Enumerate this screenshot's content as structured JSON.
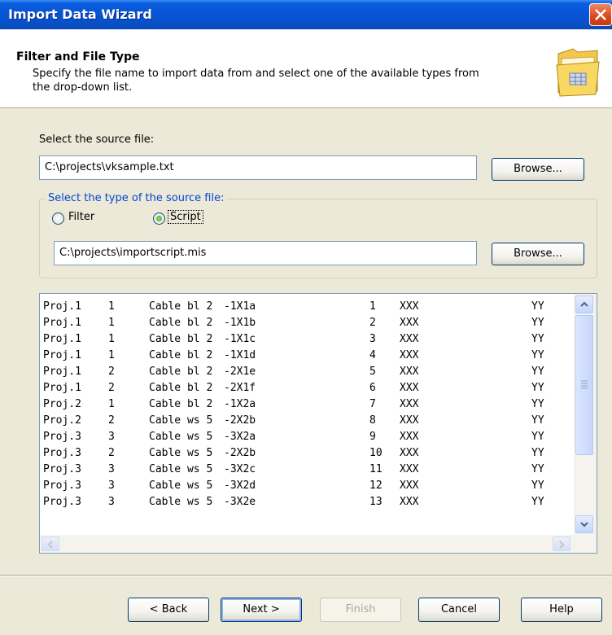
{
  "window": {
    "title": "Import Data Wizard"
  },
  "header": {
    "title": "Filter and File Type",
    "description": "Specify the file name to import data from and select one of the available types from the drop-down list."
  },
  "source_file": {
    "label": "Select the source file:",
    "value": "C:\\projects\\vksample.txt",
    "browse_label": "Browse..."
  },
  "source_type": {
    "group_label": "Select the type of the source file:",
    "options": [
      {
        "label": "Filter",
        "selected": false
      },
      {
        "label": "Script",
        "selected": true
      }
    ],
    "script_path": "C:\\projects\\importscript.mis",
    "browse_label": "Browse..."
  },
  "preview": {
    "rows": [
      [
        "Proj.1",
        "1",
        "Cable bl 2",
        "-1X1a",
        "1",
        "XXX",
        "YY"
      ],
      [
        "Proj.1",
        "1",
        "Cable bl 2",
        "-1X1b",
        "2",
        "XXX",
        "YY"
      ],
      [
        "Proj.1",
        "1",
        "Cable bl 2",
        "-1X1c",
        "3",
        "XXX",
        "YY"
      ],
      [
        "Proj.1",
        "1",
        "Cable bl 2",
        "-1X1d",
        "4",
        "XXX",
        "YY"
      ],
      [
        "Proj.1",
        "2",
        "Cable bl 2",
        "-2X1e",
        "5",
        "XXX",
        "YY"
      ],
      [
        "Proj.1",
        "2",
        "Cable bl 2",
        "-2X1f",
        "6",
        "XXX",
        "YY"
      ],
      [
        "Proj.2",
        "1",
        "Cable bl 2",
        "-1X2a",
        "7",
        "XXX",
        "YY"
      ],
      [
        "Proj.2",
        "2",
        "Cable ws 5",
        "-2X2b",
        "8",
        "XXX",
        "YY"
      ],
      [
        "Proj.3",
        "3",
        "Cable ws 5",
        "-3X2a",
        "9",
        "XXX",
        "YY"
      ],
      [
        "Proj.3",
        "2",
        "Cable ws 5",
        "-2X2b",
        "10",
        "XXX",
        "YY"
      ],
      [
        "Proj.3",
        "3",
        "Cable ws 5",
        "-3X2c",
        "11",
        "XXX",
        "YY"
      ],
      [
        "Proj.3",
        "3",
        "Cable ws 5",
        "-3X2d",
        "12",
        "XXX",
        "YY"
      ],
      [
        "Proj.3",
        "3",
        "Cable ws 5",
        "-3X2e",
        "13",
        "XXX",
        "YY"
      ]
    ]
  },
  "buttons": {
    "back": "< Back",
    "next": "Next >",
    "finish": "Finish",
    "cancel": "Cancel",
    "help": "Help"
  },
  "colors": {
    "titlebar": "#0754d4",
    "dialog_bg": "#ece9d8",
    "group_label": "#0046d5"
  }
}
